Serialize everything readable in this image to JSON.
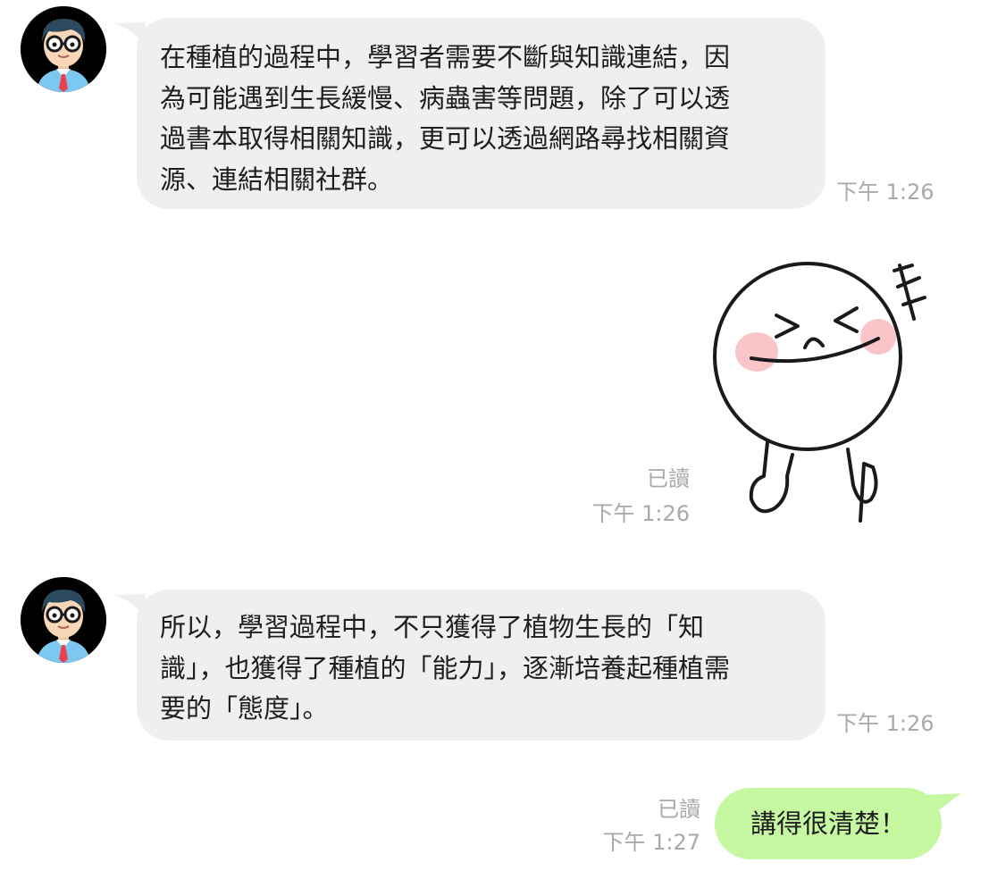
{
  "messages": [
    {
      "lines": [
        "在種植的過程中，學習者需要不斷與知識連結，因",
        "為可能遇到生長緩慢、病蟲害等問題，除了可以透",
        "過書本取得相關知識，更可以透過網路尋找相關資",
        "源、連結相關社群。"
      ],
      "time": "下午 1:26"
    },
    {
      "sticker": "laughing-face-sticker",
      "read": "已讀",
      "time": "下午 1:26"
    },
    {
      "lines": [
        "所以，學習過程中，不只獲得了植物生長的「知",
        "識」，也獲得了種植的「能力」，逐漸培養起種植需",
        "要的「態度」。"
      ],
      "time": "下午 1:26"
    },
    {
      "text": "講得很清楚！",
      "read": "已讀",
      "time": "下午 1:27"
    }
  ],
  "colors": {
    "incoming_bubble": "#efefef",
    "outgoing_bubble": "#c6f7a1",
    "meta_text": "#a9a9a9",
    "cheek": "#f9c5c8"
  }
}
